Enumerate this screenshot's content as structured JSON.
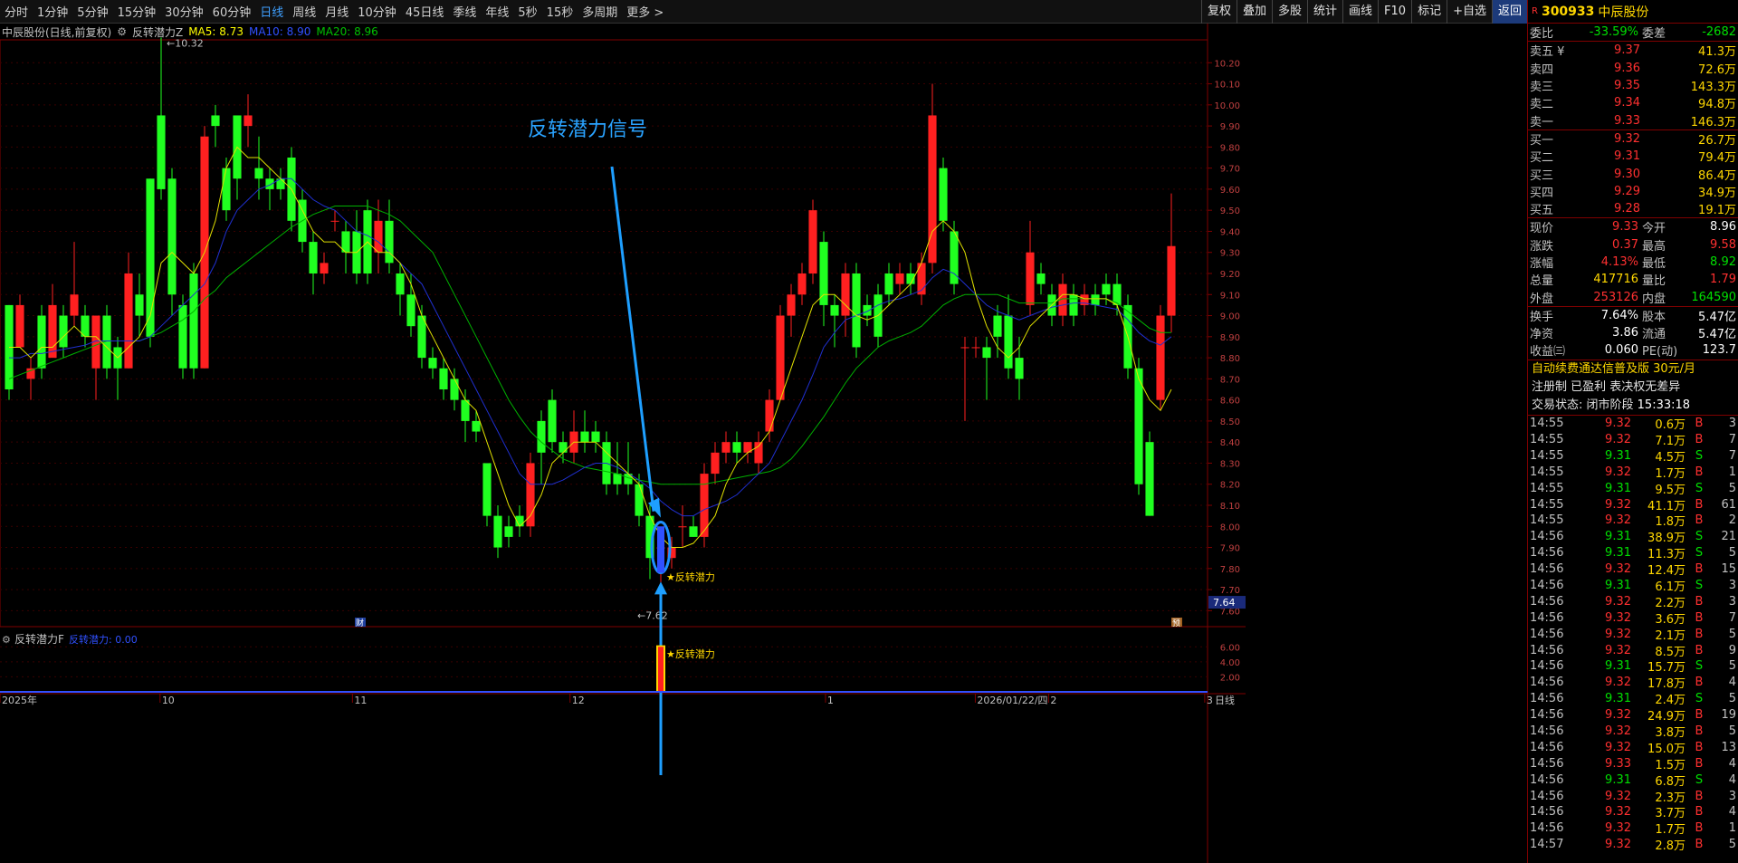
{
  "toolbar": {
    "periods": [
      "分时",
      "1分钟",
      "5分钟",
      "15分钟",
      "30分钟",
      "60分钟",
      "日线",
      "周线",
      "月线",
      "10分钟",
      "45日线",
      "季线",
      "年线",
      "5秒",
      "15秒",
      "多周期",
      "更多 >"
    ],
    "active": "日线",
    "tools": [
      "复权",
      "叠加",
      "多股",
      "统计",
      "画线",
      "F10",
      "标记",
      "+自选",
      "返回"
    ]
  },
  "info": {
    "stock": "中辰股份(日线,前复权)",
    "indicator": "反转潜力Z",
    "ma5": "MA5: 8.73",
    "ma10": "MA10: 8.90",
    "ma20": "MA20: 8.96"
  },
  "annotations": {
    "signal_title": "反转潜力信号",
    "signal_label": "★反转潜力",
    "high_label": "10.32",
    "low_label": "7.62",
    "cur_price_tag": "7.64",
    "fin_mark1": "财",
    "fin_mark2": "预"
  },
  "sub": {
    "name": "反转潜力F",
    "value_label": "反转潜力: 0.00",
    "signal_label": "★反转潜力",
    "ticks": [
      "6.00",
      "4.00",
      "2.00"
    ]
  },
  "xaxis": {
    "labels": [
      "2025年",
      "10",
      "11",
      "12",
      "1",
      "2026/01/22/四",
      "2",
      "3"
    ],
    "period_btn": "日线"
  },
  "chart_data": {
    "type": "candlestick",
    "ylim": [
      7.55,
      10.3
    ],
    "yticks": [
      "10.20",
      "10.10",
      "10.00",
      "9.90",
      "9.80",
      "9.70",
      "9.60",
      "9.50",
      "9.40",
      "9.30",
      "9.20",
      "9.10",
      "9.00",
      "8.90",
      "8.80",
      "8.70",
      "8.60",
      "8.50",
      "8.40",
      "8.30",
      "8.20",
      "8.10",
      "8.00",
      "7.90",
      "7.80",
      "7.70",
      "7.60"
    ],
    "candles": [
      [
        9.05,
        8.65,
        9.05,
        8.6
      ],
      [
        8.85,
        9.05,
        9.1,
        8.85
      ],
      [
        8.7,
        8.75,
        8.8,
        8.6
      ],
      [
        9.0,
        8.75,
        9.05,
        8.7
      ],
      [
        8.8,
        9.05,
        9.15,
        8.8
      ],
      [
        9.0,
        8.85,
        9.05,
        8.8
      ],
      [
        9.0,
        9.1,
        9.35,
        8.95
      ],
      [
        9.0,
        8.9,
        9.05,
        8.85
      ],
      [
        8.75,
        9.0,
        9.0,
        8.6
      ],
      [
        9.0,
        8.75,
        9.05,
        8.7
      ],
      [
        8.85,
        8.75,
        8.9,
        8.6
      ],
      [
        8.75,
        9.2,
        9.3,
        8.75
      ],
      [
        9.1,
        9.0,
        9.2,
        8.9
      ],
      [
        9.65,
        8.9,
        9.65,
        8.85
      ],
      [
        9.95,
        9.6,
        10.32,
        9.55
      ],
      [
        9.65,
        9.1,
        9.7,
        9.0
      ],
      [
        9.05,
        8.75,
        9.1,
        8.7
      ],
      [
        9.2,
        8.75,
        9.25,
        8.7
      ],
      [
        8.75,
        9.85,
        9.9,
        8.75
      ],
      [
        9.95,
        9.9,
        10.0,
        9.8
      ],
      [
        9.7,
        9.5,
        9.75,
        9.45
      ],
      [
        9.95,
        9.65,
        9.95,
        9.55
      ],
      [
        9.9,
        9.95,
        10.05,
        9.8
      ],
      [
        9.7,
        9.65,
        9.85,
        9.55
      ],
      [
        9.65,
        9.6,
        9.7,
        9.5
      ],
      [
        9.65,
        9.6,
        9.7,
        9.55
      ],
      [
        9.75,
        9.45,
        9.8,
        9.4
      ],
      [
        9.55,
        9.35,
        9.6,
        9.3
      ],
      [
        9.35,
        9.2,
        9.4,
        9.1
      ],
      [
        9.2,
        9.25,
        9.3,
        9.15
      ],
      [
        9.45,
        9.45,
        9.5,
        9.4
      ],
      [
        9.4,
        9.3,
        9.45,
        9.2
      ],
      [
        9.4,
        9.2,
        9.5,
        9.15
      ],
      [
        9.5,
        9.2,
        9.55,
        9.15
      ],
      [
        9.3,
        9.45,
        9.55,
        9.2
      ],
      [
        9.45,
        9.25,
        9.55,
        9.2
      ],
      [
        9.2,
        9.1,
        9.25,
        9.0
      ],
      [
        9.1,
        8.95,
        9.2,
        8.9
      ],
      [
        9.0,
        8.8,
        9.05,
        8.75
      ],
      [
        8.8,
        8.75,
        8.85,
        8.7
      ],
      [
        8.75,
        8.65,
        8.8,
        8.6
      ],
      [
        8.7,
        8.6,
        8.75,
        8.55
      ],
      [
        8.6,
        8.5,
        8.65,
        8.4
      ],
      [
        8.5,
        8.45,
        8.55,
        8.4
      ],
      [
        8.3,
        8.05,
        8.3,
        8.0
      ],
      [
        8.05,
        7.9,
        8.1,
        7.85
      ],
      [
        8.0,
        7.95,
        8.05,
        7.9
      ],
      [
        8.05,
        8.0,
        8.1,
        7.95
      ],
      [
        8.0,
        8.3,
        8.35,
        7.95
      ],
      [
        8.5,
        8.35,
        8.55,
        8.2
      ],
      [
        8.6,
        8.4,
        8.65,
        8.35
      ],
      [
        8.4,
        8.35,
        8.45,
        8.3
      ],
      [
        8.35,
        8.45,
        8.55,
        8.3
      ],
      [
        8.45,
        8.4,
        8.55,
        8.35
      ],
      [
        8.45,
        8.4,
        8.5,
        8.35
      ],
      [
        8.4,
        8.2,
        8.45,
        8.15
      ],
      [
        8.25,
        8.2,
        8.4,
        8.15
      ],
      [
        8.25,
        8.2,
        8.4,
        8.15
      ],
      [
        8.2,
        8.05,
        8.25,
        8.0
      ],
      [
        8.05,
        7.85,
        8.1,
        7.75
      ],
      [
        7.9,
        7.9,
        7.95,
        7.62
      ],
      [
        7.85,
        7.9,
        7.95,
        7.8
      ],
      [
        8.0,
        8.0,
        8.1,
        7.9
      ],
      [
        8.0,
        7.95,
        8.05,
        7.95
      ],
      [
        7.95,
        8.25,
        8.3,
        7.9
      ],
      [
        8.25,
        8.35,
        8.4,
        8.2
      ],
      [
        8.35,
        8.4,
        8.45,
        8.3
      ],
      [
        8.4,
        8.35,
        8.45,
        8.3
      ],
      [
        8.35,
        8.4,
        8.4,
        8.3
      ],
      [
        8.3,
        8.4,
        8.45,
        8.25
      ],
      [
        8.45,
        8.6,
        8.65,
        8.4
      ],
      [
        8.6,
        9.0,
        9.05,
        8.6
      ],
      [
        9.0,
        9.1,
        9.15,
        8.9
      ],
      [
        9.1,
        9.2,
        9.25,
        9.05
      ],
      [
        9.2,
        9.5,
        9.55,
        9.15
      ],
      [
        9.35,
        9.05,
        9.4,
        8.95
      ],
      [
        9.05,
        9.0,
        9.1,
        8.85
      ],
      [
        9.0,
        9.2,
        9.25,
        8.9
      ],
      [
        9.2,
        8.85,
        9.25,
        8.8
      ],
      [
        9.05,
        9.0,
        9.1,
        8.95
      ],
      [
        9.1,
        8.9,
        9.15,
        8.85
      ],
      [
        9.2,
        9.1,
        9.25,
        9.05
      ],
      [
        9.15,
        9.2,
        9.25,
        9.1
      ],
      [
        9.2,
        9.15,
        9.25,
        9.1
      ],
      [
        9.1,
        9.25,
        9.3,
        9.05
      ],
      [
        9.25,
        9.95,
        10.1,
        9.2
      ],
      [
        9.7,
        9.45,
        9.75,
        9.4
      ],
      [
        9.4,
        9.15,
        9.45,
        9.1
      ],
      [
        8.85,
        8.85,
        8.9,
        8.5
      ],
      [
        8.85,
        8.85,
        8.9,
        8.8
      ],
      [
        8.85,
        8.8,
        8.9,
        8.6
      ],
      [
        9.0,
        8.9,
        9.05,
        8.8
      ],
      [
        9.0,
        8.75,
        9.1,
        8.7
      ],
      [
        8.8,
        8.7,
        8.9,
        8.6
      ],
      [
        9.05,
        9.3,
        9.45,
        9.0
      ],
      [
        9.2,
        9.15,
        9.25,
        9.1
      ],
      [
        9.1,
        9.0,
        9.15,
        8.95
      ],
      [
        9.0,
        9.15,
        9.2,
        8.95
      ],
      [
        9.1,
        9.0,
        9.15,
        8.95
      ],
      [
        9.05,
        9.1,
        9.15,
        9.0
      ],
      [
        9.1,
        9.05,
        9.15,
        9.0
      ],
      [
        9.15,
        9.1,
        9.2,
        9.05
      ],
      [
        9.15,
        9.05,
        9.2,
        9.0
      ],
      [
        9.05,
        8.75,
        9.1,
        8.7
      ],
      [
        8.75,
        8.2,
        8.8,
        8.15
      ],
      [
        8.4,
        8.05,
        8.45,
        8.05
      ],
      [
        8.6,
        9.0,
        9.05,
        8.55
      ],
      [
        9.0,
        9.33,
        9.58,
        8.92
      ]
    ],
    "ma5": [
      8.85,
      8.85,
      8.8,
      8.85,
      8.85,
      8.9,
      8.95,
      8.9,
      8.9,
      8.85,
      8.8,
      8.85,
      8.9,
      9.0,
      9.25,
      9.3,
      9.25,
      9.2,
      9.3,
      9.45,
      9.7,
      9.8,
      9.75,
      9.75,
      9.7,
      9.65,
      9.6,
      9.5,
      9.4,
      9.35,
      9.35,
      9.3,
      9.3,
      9.35,
      9.3,
      9.3,
      9.25,
      9.15,
      9.0,
      8.9,
      8.8,
      8.7,
      8.6,
      8.55,
      8.4,
      8.25,
      8.1,
      8.0,
      8.05,
      8.15,
      8.3,
      8.35,
      8.4,
      8.4,
      8.4,
      8.35,
      8.3,
      8.25,
      8.2,
      8.05,
      7.95,
      7.9,
      7.9,
      7.92,
      7.98,
      8.05,
      8.2,
      8.3,
      8.35,
      8.38,
      8.45,
      8.6,
      8.75,
      8.9,
      9.05,
      9.1,
      9.1,
      9.05,
      9.0,
      8.98,
      9.0,
      9.05,
      9.1,
      9.15,
      9.25,
      9.4,
      9.45,
      9.4,
      9.3,
      9.1,
      8.95,
      8.85,
      8.8,
      8.85,
      8.95,
      9.0,
      9.05,
      9.1,
      9.1,
      9.08,
      9.08,
      9.08,
      9.05,
      8.9,
      8.7,
      8.6,
      8.55,
      8.65
    ],
    "ma10": [
      8.8,
      8.8,
      8.82,
      8.82,
      8.83,
      8.84,
      8.85,
      8.86,
      8.88,
      8.88,
      8.88,
      8.88,
      8.88,
      8.9,
      8.95,
      9.0,
      9.05,
      9.1,
      9.15,
      9.25,
      9.4,
      9.5,
      9.55,
      9.6,
      9.62,
      9.65,
      9.65,
      9.6,
      9.55,
      9.52,
      9.5,
      9.45,
      9.4,
      9.38,
      9.35,
      9.3,
      9.25,
      9.2,
      9.15,
      9.05,
      8.95,
      8.85,
      8.75,
      8.65,
      8.55,
      8.45,
      8.35,
      8.25,
      8.2,
      8.2,
      8.2,
      8.22,
      8.25,
      8.28,
      8.3,
      8.3,
      8.28,
      8.25,
      8.22,
      8.18,
      8.12,
      8.08,
      8.05,
      8.05,
      8.08,
      8.1,
      8.12,
      8.15,
      8.2,
      8.25,
      8.3,
      8.4,
      8.5,
      8.6,
      8.72,
      8.85,
      8.92,
      8.98,
      9.0,
      9.02,
      9.05,
      9.07,
      9.08,
      9.1,
      9.12,
      9.18,
      9.22,
      9.2,
      9.15,
      9.1,
      9.05,
      9.02,
      9.0,
      8.98,
      9.0,
      9.02,
      9.04,
      9.05,
      9.06,
      9.06,
      9.05,
      9.04,
      9.03,
      8.98,
      8.92,
      8.88,
      8.86,
      8.9
    ],
    "ma20": [
      8.7,
      8.72,
      8.74,
      8.76,
      8.78,
      8.8,
      8.82,
      8.84,
      8.86,
      8.88,
      8.88,
      8.88,
      8.88,
      8.9,
      8.92,
      8.95,
      8.98,
      9.02,
      9.08,
      9.12,
      9.18,
      9.22,
      9.26,
      9.3,
      9.34,
      9.38,
      9.42,
      9.45,
      9.48,
      9.5,
      9.52,
      9.52,
      9.52,
      9.52,
      9.5,
      9.48,
      9.45,
      9.4,
      9.35,
      9.3,
      9.2,
      9.1,
      9.0,
      8.9,
      8.8,
      8.7,
      8.6,
      8.52,
      8.45,
      8.4,
      8.36,
      8.32,
      8.3,
      8.28,
      8.27,
      8.26,
      8.25,
      8.23,
      8.22,
      8.21,
      8.2,
      8.2,
      8.2,
      8.2,
      8.2,
      8.21,
      8.22,
      8.23,
      8.24,
      8.25,
      8.26,
      8.28,
      8.32,
      8.38,
      8.45,
      8.52,
      8.6,
      8.68,
      8.75,
      8.8,
      8.85,
      8.88,
      8.9,
      8.92,
      8.95,
      9.0,
      9.05,
      9.08,
      9.1,
      9.1,
      9.1,
      9.1,
      9.08,
      9.06,
      9.06,
      9.06,
      9.06,
      9.08,
      9.08,
      9.08,
      9.08,
      9.08,
      9.06,
      9.02,
      8.98,
      8.94,
      8.92,
      8.92
    ]
  },
  "side": {
    "badge": "R",
    "code": "300933",
    "name": "中辰股份",
    "weibi_lbl": "委比",
    "weibi": "-33.59%",
    "weicha_lbl": "委差",
    "weicha": "-2682",
    "sell": [
      {
        "label": "卖五 ¥",
        "price": "9.37",
        "vol": "41.3万"
      },
      {
        "label": "卖四",
        "price": "9.36",
        "vol": "72.6万"
      },
      {
        "label": "卖三",
        "price": "9.35",
        "vol": "143.3万"
      },
      {
        "label": "卖二",
        "price": "9.34",
        "vol": "94.8万"
      },
      {
        "label": "卖一",
        "price": "9.33",
        "vol": "146.3万"
      }
    ],
    "buy": [
      {
        "label": "买一",
        "price": "9.32",
        "vol": "26.7万"
      },
      {
        "label": "买二",
        "price": "9.31",
        "vol": "79.4万"
      },
      {
        "label": "买三",
        "price": "9.30",
        "vol": "86.4万"
      },
      {
        "label": "买四",
        "price": "9.29",
        "vol": "34.9万"
      },
      {
        "label": "买五",
        "price": "9.28",
        "vol": "19.1万"
      }
    ],
    "stats": [
      {
        "k": "现价",
        "v": "9.33",
        "vc": "red",
        "k2": "今开",
        "v2": "8.96",
        "v2c": "wht"
      },
      {
        "k": "涨跌",
        "v": "0.37",
        "vc": "red",
        "k2": "最高",
        "v2": "9.58",
        "v2c": "red"
      },
      {
        "k": "涨幅",
        "v": "4.13%",
        "vc": "red",
        "k2": "最低",
        "v2": "8.92",
        "v2c": "green"
      },
      {
        "k": "总量",
        "v": "417716",
        "vc": "yel",
        "k2": "量比",
        "v2": "1.79",
        "v2c": "red"
      },
      {
        "k": "外盘",
        "v": "253126",
        "vc": "red",
        "k2": "内盘",
        "v2": "164590",
        "v2c": "green"
      }
    ],
    "stats2": [
      {
        "k": "换手",
        "v": "7.64%",
        "vc": "wht",
        "k2": "股本",
        "v2": "5.47亿",
        "v2c": "wht"
      },
      {
        "k": "净资",
        "v": "3.86",
        "vc": "wht",
        "k2": "流通",
        "v2": "5.47亿",
        "v2c": "wht"
      },
      {
        "k": "收益㈢",
        "v": "0.060",
        "vc": "wht",
        "k2": "PE(动)",
        "v2": "123.7",
        "v2c": "wht"
      }
    ],
    "promo": "自动续费通达信普及版  30元/月",
    "reg": "注册制 已盈利 表决权无差异",
    "status_lbl": "交易状态: 闭市阶段",
    "status_time": "15:33:18",
    "trades": [
      [
        "14:55",
        "9.32",
        "0.6万",
        "B",
        "3"
      ],
      [
        "14:55",
        "9.32",
        "7.1万",
        "B",
        "7"
      ],
      [
        "14:55",
        "9.31",
        "4.5万",
        "S",
        "7"
      ],
      [
        "14:55",
        "9.32",
        "1.7万",
        "B",
        "1"
      ],
      [
        "14:55",
        "9.31",
        "9.5万",
        "S",
        "5"
      ],
      [
        "14:55",
        "9.32",
        "41.1万",
        "B",
        "61"
      ],
      [
        "14:55",
        "9.32",
        "1.8万",
        "B",
        "2"
      ],
      [
        "14:56",
        "9.31",
        "38.9万",
        "S",
        "21"
      ],
      [
        "14:56",
        "9.31",
        "11.3万",
        "S",
        "5"
      ],
      [
        "14:56",
        "9.32",
        "12.4万",
        "B",
        "15"
      ],
      [
        "14:56",
        "9.31",
        "6.1万",
        "S",
        "3"
      ],
      [
        "14:56",
        "9.32",
        "2.2万",
        "B",
        "3"
      ],
      [
        "14:56",
        "9.32",
        "3.6万",
        "B",
        "7"
      ],
      [
        "14:56",
        "9.32",
        "2.1万",
        "B",
        "5"
      ],
      [
        "14:56",
        "9.32",
        "8.5万",
        "B",
        "9"
      ],
      [
        "14:56",
        "9.31",
        "15.7万",
        "S",
        "5"
      ],
      [
        "14:56",
        "9.32",
        "17.8万",
        "B",
        "4"
      ],
      [
        "14:56",
        "9.31",
        "2.4万",
        "S",
        "5"
      ],
      [
        "14:56",
        "9.32",
        "24.9万",
        "B",
        "19"
      ],
      [
        "14:56",
        "9.32",
        "3.8万",
        "B",
        "5"
      ],
      [
        "14:56",
        "9.32",
        "15.0万",
        "B",
        "13"
      ],
      [
        "14:56",
        "9.33",
        "1.5万",
        "B",
        "4"
      ],
      [
        "14:56",
        "9.31",
        "6.8万",
        "S",
        "4"
      ],
      [
        "14:56",
        "9.32",
        "2.3万",
        "B",
        "3"
      ],
      [
        "14:56",
        "9.32",
        "3.7万",
        "B",
        "4"
      ],
      [
        "14:56",
        "9.32",
        "1.7万",
        "B",
        "1"
      ],
      [
        "14:57",
        "9.32",
        "2.8万",
        "B",
        "5"
      ]
    ]
  }
}
